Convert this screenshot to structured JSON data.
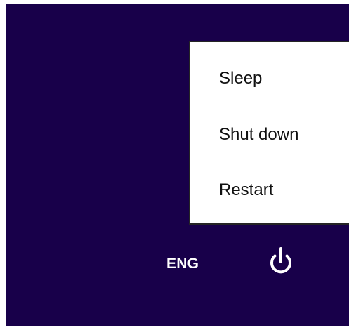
{
  "power_menu": {
    "items": [
      {
        "label": "Sleep"
      },
      {
        "label": "Shut down"
      },
      {
        "label": "Restart"
      }
    ]
  },
  "status_bar": {
    "language": "ENG",
    "power_icon": "power-icon"
  },
  "colors": {
    "background": "#18004a",
    "menu_background": "#ffffff",
    "menu_border": "#252525",
    "text_dark": "#111111",
    "text_light": "#ffffff"
  }
}
